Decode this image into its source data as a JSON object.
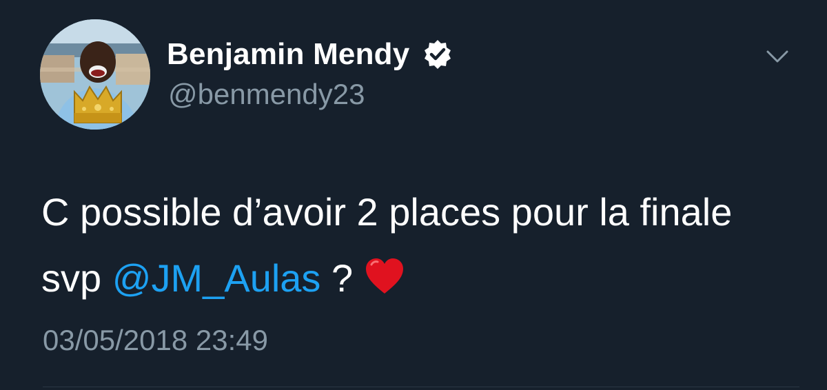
{
  "user": {
    "display_name": "Benjamin Mendy",
    "handle": "@benmendy23",
    "verified": true
  },
  "tweet": {
    "text_before": "C possible d’avoir 2 places pour la finale svp ",
    "mention": "@JM_Aulas",
    "text_after": " ? ",
    "emoji": "heart-icon",
    "timestamp": "03/05/2018 23:49"
  },
  "colors": {
    "background": "#16202c",
    "text": "#ffffff",
    "secondary": "#8899a6",
    "link": "#1da1f2",
    "heart": "#e0121f"
  }
}
